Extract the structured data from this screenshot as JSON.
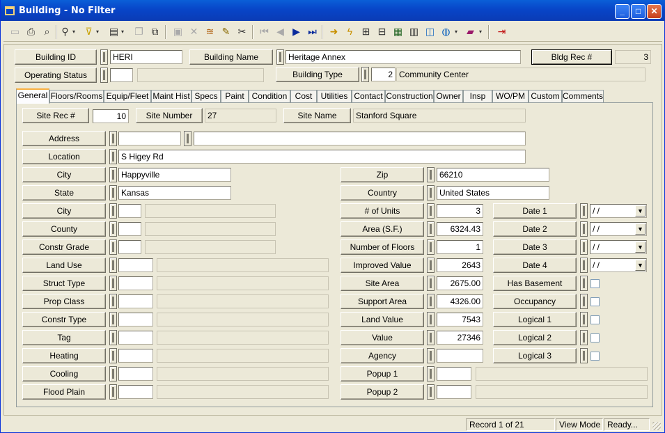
{
  "window": {
    "title": "Building - No Filter",
    "minimize": "_",
    "maximize": "□",
    "close": "✕"
  },
  "toolbar": {
    "icons": [
      "new-icon",
      "print-icon",
      "print-preview-icon",
      "find-icon",
      "filter-icon",
      "report-icon",
      "copy-icon",
      "duplicate-icon",
      "save-icon",
      "delete-icon",
      "layers-icon",
      "edit-icon",
      "cut-icon",
      "first-record-icon",
      "prev-record-icon",
      "next-record-icon",
      "last-record-icon",
      "go-to-icon",
      "lightning-icon",
      "hierarchy-icon",
      "map-icon",
      "calculator-icon",
      "gis-icon",
      "globe-icon",
      "book-icon",
      "exit-icon"
    ]
  },
  "header": {
    "building_id_label": "Building ID",
    "building_id": "HERI",
    "building_name_label": "Building Name",
    "building_name": "Heritage Annex",
    "bldg_rec_label": "Bldg Rec #",
    "bldg_rec": "3",
    "operating_status_label": "Operating Status",
    "operating_status": "",
    "operating_status_desc": "",
    "building_type_label": "Building Type",
    "building_type": "2",
    "building_type_desc": "Community Center"
  },
  "tabs": [
    "General",
    "Floors/Rooms",
    "Equip/Fleet",
    "Maint Hist",
    "Specs",
    "Paint",
    "Condition",
    "Cost",
    "Utilities",
    "Contact",
    "Construction",
    "Owner",
    "Insp",
    "WO/PM",
    "Custom",
    "Comments"
  ],
  "general": {
    "site_rec_label": "Site Rec #",
    "site_rec": "10",
    "site_number_label": "Site Number",
    "site_number": "27",
    "site_name_label": "Site Name",
    "site_name": "Stanford Square",
    "address_label": "Address",
    "address1": "",
    "address2": "",
    "location_label": "Location",
    "location": "S Higey Rd",
    "city_label": "City",
    "city": "Happyville",
    "state_label": "State",
    "state": "Kansas",
    "zip_label": "Zip",
    "zip": "66210",
    "country_label": "Country",
    "country": "United States",
    "left_codes": [
      {
        "label": "City",
        "code": "",
        "desc": ""
      },
      {
        "label": "County",
        "code": "",
        "desc": ""
      },
      {
        "label": "Constr Grade",
        "code": "",
        "desc": ""
      },
      {
        "label": "Land Use",
        "code": "",
        "desc": ""
      },
      {
        "label": "Struct Type",
        "code": "",
        "desc": ""
      },
      {
        "label": "Prop Class",
        "code": "",
        "desc": ""
      },
      {
        "label": "Constr Type",
        "code": "",
        "desc": ""
      },
      {
        "label": "Tag",
        "code": "",
        "desc": ""
      },
      {
        "label": "Heating",
        "code": "",
        "desc": ""
      },
      {
        "label": "Cooling",
        "code": "",
        "desc": ""
      },
      {
        "label": "Flood Plain",
        "code": "",
        "desc": ""
      }
    ],
    "mid_fields": [
      {
        "label": "# of Units",
        "value": "3"
      },
      {
        "label": "Area (S.F.)",
        "value": "6324.43"
      },
      {
        "label": "Number of Floors",
        "value": "1"
      },
      {
        "label": "Improved Value",
        "value": "2643"
      },
      {
        "label": "Site Area",
        "value": "2675.00"
      },
      {
        "label": "Support Area",
        "value": "4326.00"
      },
      {
        "label": "Land Value",
        "value": "7543"
      },
      {
        "label": "Value",
        "value": "27346"
      },
      {
        "label": "Agency",
        "value": ""
      }
    ],
    "popups": [
      {
        "label": "Popup 1",
        "code": "",
        "desc": ""
      },
      {
        "label": "Popup 2",
        "code": "",
        "desc": ""
      }
    ],
    "dates": [
      {
        "label": "Date 1",
        "value": " / /"
      },
      {
        "label": "Date 2",
        "value": " / /"
      },
      {
        "label": "Date 3",
        "value": " / /"
      },
      {
        "label": "Date 4",
        "value": " / /"
      }
    ],
    "flags": [
      {
        "label": "Has Basement"
      },
      {
        "label": "Occupancy"
      },
      {
        "label": "Logical 1"
      },
      {
        "label": "Logical 2"
      },
      {
        "label": "Logical 3"
      }
    ]
  },
  "status": {
    "record": "Record 1 of 21",
    "mode": "View Mode",
    "state": "Ready..."
  }
}
